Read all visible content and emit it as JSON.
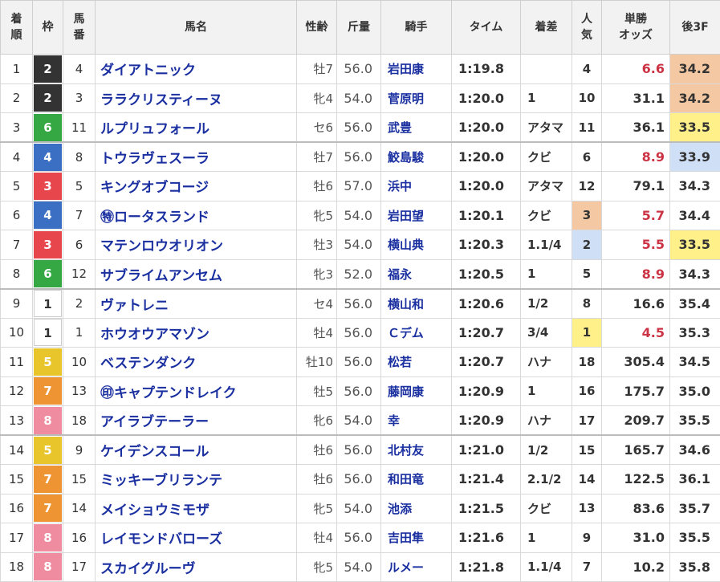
{
  "headers": {
    "rank": [
      "着",
      "順"
    ],
    "waku": "枠",
    "num": [
      "馬",
      "番"
    ],
    "name": "馬名",
    "sexage": "性齢",
    "weight": "斤量",
    "jockey": "騎手",
    "time": "タイム",
    "margin": "着差",
    "pop": [
      "人",
      "気"
    ],
    "odds": [
      "単勝",
      "オッズ"
    ],
    "last3f": "後3F"
  },
  "colors": {
    "waku_1": "#ffffff",
    "waku_2": "#333333",
    "waku_3": "#e8464d",
    "waku_4": "#3a6fc4",
    "waku_5": "#e8c52a",
    "waku_6": "#35a844",
    "waku_7": "#ef9433",
    "waku_8": "#f08ca0",
    "highlight_orange": "#f4c8a2",
    "highlight_blue": "#cfe0f6",
    "highlight_yellow": "#fff08a",
    "odds_red": "#cc3344",
    "link_blue": "#1a2fa0"
  },
  "rows": [
    {
      "rank": "1",
      "waku": "2",
      "num": "4",
      "name": "ダイアトニック",
      "sexage": "牡7",
      "weight": "56.0",
      "jockey": "岩田康",
      "time": "1:19.8",
      "margin": "",
      "pop": "4",
      "odds": "6.6",
      "last3f": "34.2",
      "odds_red": true,
      "pop_hl": "",
      "last_hl": "orange",
      "sep": false
    },
    {
      "rank": "2",
      "waku": "2",
      "num": "3",
      "name": "ララクリスティーヌ",
      "sexage": "牝4",
      "weight": "54.0",
      "jockey": "菅原明",
      "time": "1:20.0",
      "margin": "1",
      "pop": "10",
      "odds": "31.1",
      "last3f": "34.2",
      "odds_red": false,
      "pop_hl": "",
      "last_hl": "orange",
      "sep": false
    },
    {
      "rank": "3",
      "waku": "6",
      "num": "11",
      "name": "ルプリュフォール",
      "sexage": "セ6",
      "weight": "56.0",
      "jockey": "武豊",
      "time": "1:20.0",
      "margin": "アタマ",
      "pop": "11",
      "odds": "36.1",
      "last3f": "33.5",
      "odds_red": false,
      "pop_hl": "",
      "last_hl": "yellow",
      "sep": false
    },
    {
      "rank": "4",
      "waku": "4",
      "num": "8",
      "name": "トウラヴェスーラ",
      "sexage": "牡7",
      "weight": "56.0",
      "jockey": "鮫島駿",
      "time": "1:20.0",
      "margin": "クビ",
      "pop": "6",
      "odds": "8.9",
      "last3f": "33.9",
      "odds_red": true,
      "pop_hl": "",
      "last_hl": "blue",
      "sep": true
    },
    {
      "rank": "5",
      "waku": "3",
      "num": "5",
      "name": "キングオブコージ",
      "sexage": "牡6",
      "weight": "57.0",
      "jockey": "浜中",
      "time": "1:20.0",
      "margin": "アタマ",
      "pop": "12",
      "odds": "79.1",
      "last3f": "34.3",
      "odds_red": false,
      "pop_hl": "",
      "last_hl": "",
      "sep": false
    },
    {
      "rank": "6",
      "waku": "4",
      "num": "7",
      "name": "㊕ロータスランド",
      "sexage": "牝5",
      "weight": "54.0",
      "jockey": "岩田望",
      "time": "1:20.1",
      "margin": "クビ",
      "pop": "3",
      "odds": "5.7",
      "last3f": "34.4",
      "odds_red": true,
      "pop_hl": "orange",
      "last_hl": "",
      "sep": false
    },
    {
      "rank": "7",
      "waku": "3",
      "num": "6",
      "name": "マテンロウオリオン",
      "sexage": "牡3",
      "weight": "54.0",
      "jockey": "横山典",
      "time": "1:20.3",
      "margin": "1.1/4",
      "pop": "2",
      "odds": "5.5",
      "last3f": "33.5",
      "odds_red": true,
      "pop_hl": "blue",
      "last_hl": "yellow",
      "sep": false
    },
    {
      "rank": "8",
      "waku": "6",
      "num": "12",
      "name": "サブライムアンセム",
      "sexage": "牝3",
      "weight": "52.0",
      "jockey": "福永",
      "time": "1:20.5",
      "margin": "1",
      "pop": "5",
      "odds": "8.9",
      "last3f": "34.3",
      "odds_red": true,
      "pop_hl": "",
      "last_hl": "",
      "sep": false
    },
    {
      "rank": "9",
      "waku": "1",
      "num": "2",
      "name": "ヴァトレニ",
      "sexage": "セ4",
      "weight": "56.0",
      "jockey": "横山和",
      "time": "1:20.6",
      "margin": "1/2",
      "pop": "8",
      "odds": "16.6",
      "last3f": "35.4",
      "odds_red": false,
      "pop_hl": "",
      "last_hl": "",
      "sep": true
    },
    {
      "rank": "10",
      "waku": "1",
      "num": "1",
      "name": "ホウオウアマゾン",
      "sexage": "牡4",
      "weight": "56.0",
      "jockey": "Ｃデム",
      "time": "1:20.7",
      "margin": "3/4",
      "pop": "1",
      "odds": "4.5",
      "last3f": "35.3",
      "odds_red": true,
      "pop_hl": "yellow",
      "last_hl": "",
      "sep": false
    },
    {
      "rank": "11",
      "waku": "5",
      "num": "10",
      "name": "ベステンダンク",
      "sexage": "牡10",
      "weight": "56.0",
      "jockey": "松若",
      "time": "1:20.7",
      "margin": "ハナ",
      "pop": "18",
      "odds": "305.4",
      "last3f": "34.5",
      "odds_red": false,
      "pop_hl": "",
      "last_hl": "",
      "sep": false
    },
    {
      "rank": "12",
      "waku": "7",
      "num": "13",
      "name": "㊞キャプテンドレイク",
      "sexage": "牡5",
      "weight": "56.0",
      "jockey": "藤岡康",
      "time": "1:20.9",
      "margin": "1",
      "pop": "16",
      "odds": "175.7",
      "last3f": "35.0",
      "odds_red": false,
      "pop_hl": "",
      "last_hl": "",
      "sep": false
    },
    {
      "rank": "13",
      "waku": "8",
      "num": "18",
      "name": "アイラブテーラー",
      "sexage": "牝6",
      "weight": "54.0",
      "jockey": "幸",
      "time": "1:20.9",
      "margin": "ハナ",
      "pop": "17",
      "odds": "209.7",
      "last3f": "35.5",
      "odds_red": false,
      "pop_hl": "",
      "last_hl": "",
      "sep": false
    },
    {
      "rank": "14",
      "waku": "5",
      "num": "9",
      "name": "ケイデンスコール",
      "sexage": "牡6",
      "weight": "56.0",
      "jockey": "北村友",
      "time": "1:21.0",
      "margin": "1/2",
      "pop": "15",
      "odds": "165.7",
      "last3f": "34.6",
      "odds_red": false,
      "pop_hl": "",
      "last_hl": "",
      "sep": true
    },
    {
      "rank": "15",
      "waku": "7",
      "num": "15",
      "name": "ミッキーブリランテ",
      "sexage": "牡6",
      "weight": "56.0",
      "jockey": "和田竜",
      "time": "1:21.4",
      "margin": "2.1/2",
      "pop": "14",
      "odds": "122.5",
      "last3f": "36.1",
      "odds_red": false,
      "pop_hl": "",
      "last_hl": "",
      "sep": false
    },
    {
      "rank": "16",
      "waku": "7",
      "num": "14",
      "name": "メイショウミモザ",
      "sexage": "牝5",
      "weight": "54.0",
      "jockey": "池添",
      "time": "1:21.5",
      "margin": "クビ",
      "pop": "13",
      "odds": "83.6",
      "last3f": "35.7",
      "odds_red": false,
      "pop_hl": "",
      "last_hl": "",
      "sep": false
    },
    {
      "rank": "17",
      "waku": "8",
      "num": "16",
      "name": "レイモンドバローズ",
      "sexage": "牡4",
      "weight": "56.0",
      "jockey": "吉田隼",
      "time": "1:21.6",
      "margin": "1",
      "pop": "9",
      "odds": "31.0",
      "last3f": "35.5",
      "odds_red": false,
      "pop_hl": "",
      "last_hl": "",
      "sep": false
    },
    {
      "rank": "18",
      "waku": "8",
      "num": "17",
      "name": "スカイグルーヴ",
      "sexage": "牝5",
      "weight": "54.0",
      "jockey": "ルメー",
      "time": "1:21.8",
      "margin": "1.1/4",
      "pop": "7",
      "odds": "10.2",
      "last3f": "35.8",
      "odds_red": false,
      "pop_hl": "",
      "last_hl": "",
      "sep": false
    }
  ]
}
